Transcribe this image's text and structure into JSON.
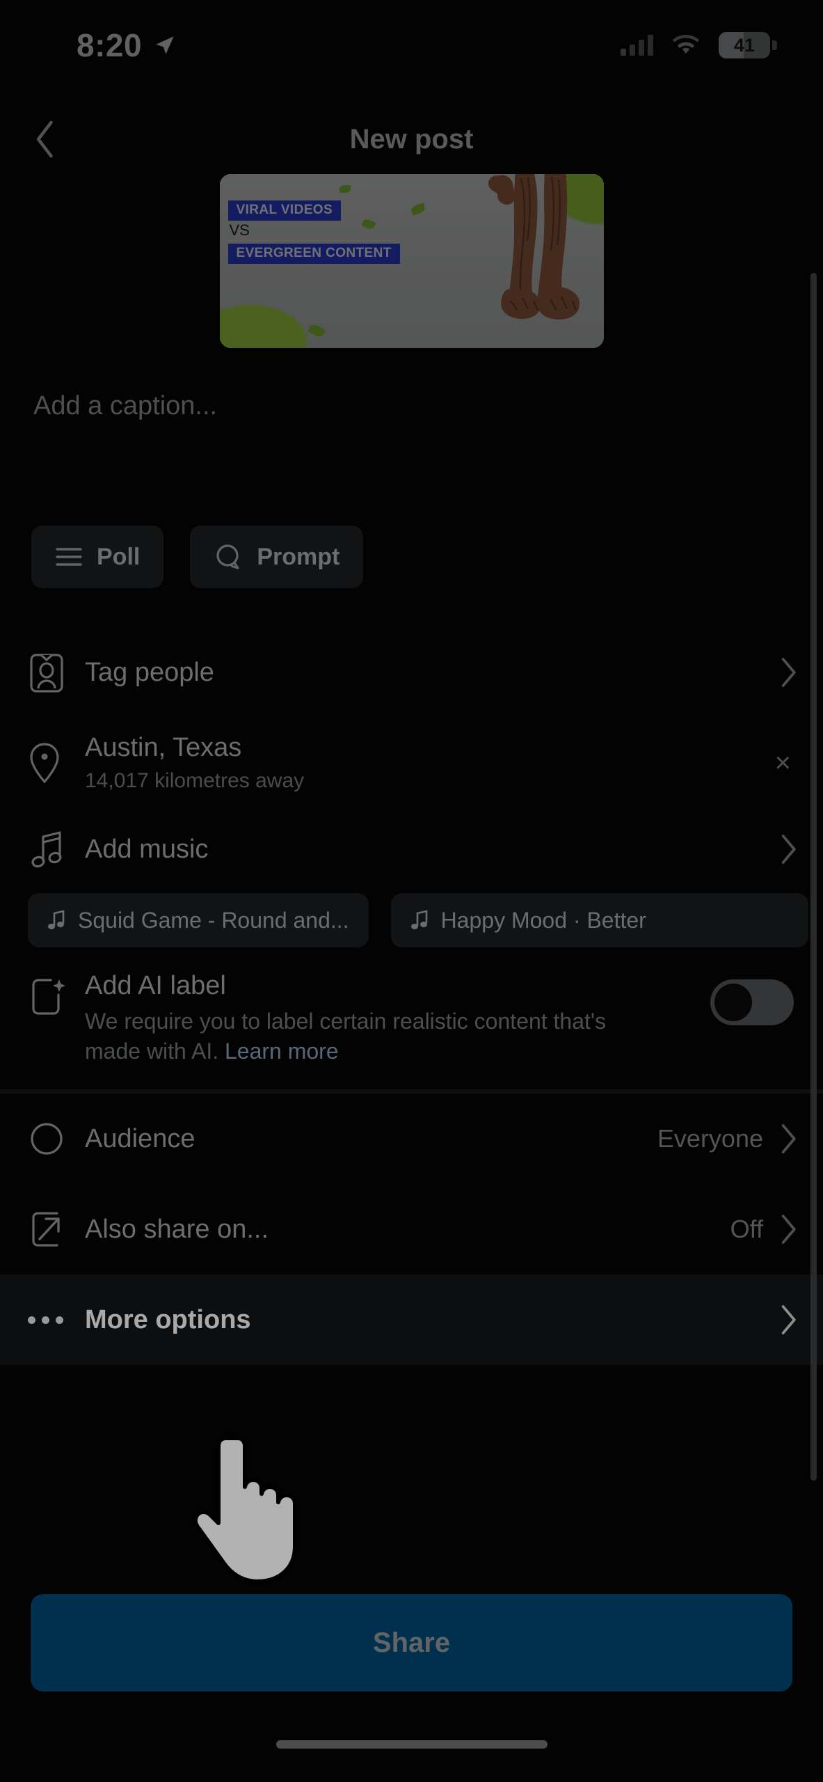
{
  "status_bar": {
    "time": "8:20",
    "location_icon": "location-arrow-icon",
    "cellular_icon": "cellular-bars-icon",
    "wifi_icon": "wifi-icon",
    "battery_percent": "41"
  },
  "header": {
    "back_icon": "chevron-left-icon",
    "title": "New post"
  },
  "media": {
    "overlay_line1": "VIRAL VIDEOS",
    "overlay_line2": "VS",
    "overlay_line3": "EVERGREEN CONTENT"
  },
  "caption": {
    "placeholder": "Add a caption...",
    "value": ""
  },
  "chips": [
    {
      "label": "Poll",
      "icon": "poll-lines-icon"
    },
    {
      "label": "Prompt",
      "icon": "prompt-bubble-icon"
    }
  ],
  "rows": {
    "tag_people": {
      "label": "Tag people",
      "icon": "person-card-icon",
      "chevron": "chevron-right-icon"
    },
    "location": {
      "label": "Austin, Texas",
      "sublabel": "14,017 kilometres away",
      "icon": "location-pin-icon",
      "clear": "×"
    },
    "add_music": {
      "label": "Add music",
      "icon": "music-note-icon",
      "chevron": "chevron-right-icon"
    },
    "ai_label": {
      "title": "Add AI label",
      "description": "We require you to label certain realistic content that's made with AI. ",
      "learn_more": "Learn more",
      "icon": "ai-sparkle-icon",
      "toggle_state": "off"
    },
    "audience": {
      "label": "Audience",
      "value": "Everyone",
      "icon": "audience-icon",
      "chevron": "chevron-right-icon"
    },
    "also_share": {
      "label": "Also share on...",
      "value": "Off",
      "icon": "share-arrow-icon",
      "chevron": "chevron-right-icon"
    },
    "more_options": {
      "label": "More options",
      "icon": "ellipsis-icon",
      "chevron": "chevron-right-icon"
    }
  },
  "music_suggestions": [
    {
      "label": "Squid Game - Round and...",
      "icon": "music-note-icon"
    },
    {
      "label": "Happy Mood · Better",
      "icon": "music-note-icon"
    }
  ],
  "share": {
    "label": "Share"
  },
  "colors": {
    "share_button": "#00466f",
    "accent_link": "#7e95ad",
    "overlay_bar": "#2b3bc9"
  },
  "cursor": {
    "icon": "pointing-hand-cursor"
  }
}
